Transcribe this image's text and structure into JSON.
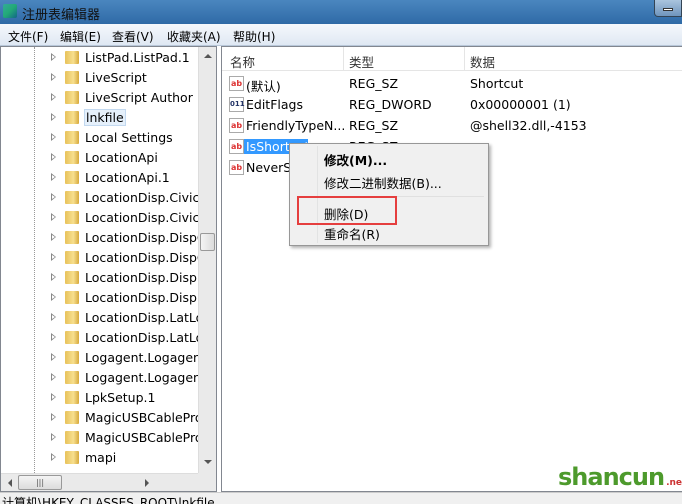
{
  "window": {
    "title": "注册表编辑器"
  },
  "menu": [
    "文件(F)",
    "编辑(E)",
    "查看(V)",
    "收藏夹(A)",
    "帮助(H)"
  ],
  "tree": [
    {
      "label": "ListPad.ListPad.1"
    },
    {
      "label": "LiveScript"
    },
    {
      "label": "LiveScript Author"
    },
    {
      "label": "lnkfile",
      "selected": true
    },
    {
      "label": "Local Settings"
    },
    {
      "label": "LocationApi"
    },
    {
      "label": "LocationApi.1"
    },
    {
      "label": "LocationDisp.CivicAd"
    },
    {
      "label": "LocationDisp.CivicAd"
    },
    {
      "label": "LocationDisp.DispCi"
    },
    {
      "label": "LocationDisp.DispCi"
    },
    {
      "label": "LocationDisp.DispLa"
    },
    {
      "label": "LocationDisp.DispLa"
    },
    {
      "label": "LocationDisp.LatLon"
    },
    {
      "label": "LocationDisp.LatLon"
    },
    {
      "label": "Logagent.Logagent"
    },
    {
      "label": "Logagent.Logagent"
    },
    {
      "label": "LpkSetup.1"
    },
    {
      "label": "MagicUSBCablePro"
    },
    {
      "label": "MagicUSBCablePro"
    },
    {
      "label": "mapi"
    }
  ],
  "columns": [
    "名称",
    "类型",
    "数据"
  ],
  "values": [
    {
      "name": "(默认)",
      "type": "REG_SZ",
      "data": "Shortcut",
      "icon": "string-value-icon"
    },
    {
      "name": "EditFlags",
      "type": "REG_DWORD",
      "data": "0x00000001 (1)",
      "icon": "binary-value-icon"
    },
    {
      "name": "FriendlyTypeN...",
      "type": "REG_SZ",
      "data": "@shell32.dll,-4153",
      "icon": "string-value-icon"
    },
    {
      "name": "IsShortcut",
      "type": "REG_SZ",
      "data": "",
      "icon": "string-value-icon",
      "selected": true
    },
    {
      "name": "NeverShowExt",
      "type": "",
      "data": "",
      "icon": "string-value-icon"
    }
  ],
  "context_menu": {
    "modify": "修改(M)...",
    "modify_binary": "修改二进制数据(B)...",
    "delete": "删除(D)",
    "rename": "重命名(R)"
  },
  "highlight_color": "#e53e3e",
  "status": "计算机\\HKEY_CLASSES_ROOT\\lnkfile",
  "watermark": "shancun.net 山村网"
}
